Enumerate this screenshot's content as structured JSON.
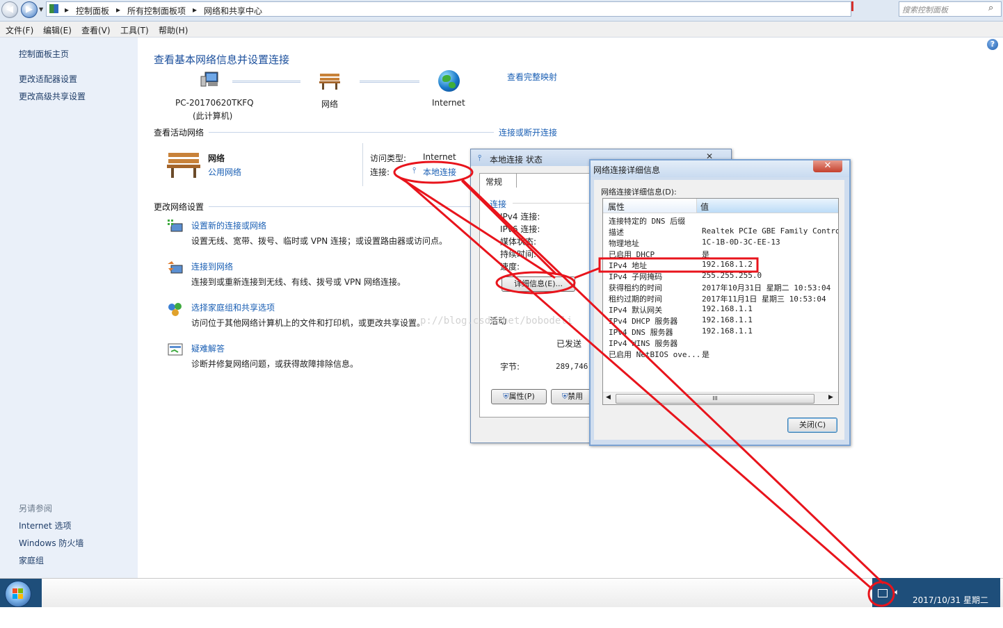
{
  "address": {
    "crumbs": [
      "控制面板",
      "所有控制面板项",
      "网络和共享中心"
    ],
    "search_placeholder": "搜索控制面板"
  },
  "menu": [
    "文件(F)",
    "编辑(E)",
    "查看(V)",
    "工具(T)",
    "帮助(H)"
  ],
  "sidebar": {
    "items": [
      "控制面板主页",
      "更改适配器设置",
      "更改高级共享设置"
    ],
    "see_also_title": "另请参阅",
    "see_also": [
      "Internet 选项",
      "Windows 防火墙",
      "家庭组"
    ]
  },
  "main": {
    "title": "查看基本网络信息并设置连接",
    "full_map": "查看完整映射",
    "map": {
      "computer_name": "PC-20170620TKFQ",
      "computer_sub": "(此计算机)",
      "network": "网络",
      "internet": "Internet"
    },
    "active_title": "查看活动网络",
    "connect_disconnect": "连接或断开连接",
    "active_network": {
      "name": "网络",
      "type": "公用网络",
      "access_label": "访问类型:",
      "access_value": "Internet",
      "conn_label": "连接:",
      "conn_value": "本地连接"
    },
    "change_title": "更改网络设置",
    "tasks": [
      {
        "title": "设置新的连接或网络",
        "desc": "设置无线、宽带、拨号、临时或 VPN 连接；或设置路由器或访问点。"
      },
      {
        "title": "连接到网络",
        "desc": "连接到或重新连接到无线、有线、拨号或 VPN 网络连接。"
      },
      {
        "title": "选择家庭组和共享选项",
        "desc": "访问位于其他网络计算机上的文件和打印机，或更改共享设置。"
      },
      {
        "title": "疑难解答",
        "desc": "诊断并修复网络问题，或获得故障排除信息。"
      }
    ]
  },
  "status_dialog": {
    "title": "本地连接 状态",
    "close": "✕",
    "tab": "常规",
    "group_connection": "连接",
    "labels": [
      "IPv4 连接:",
      "IPv6 连接:",
      "媒体状态:",
      "持续时间:",
      "速度:"
    ],
    "details_button": "详细信息(E)...",
    "group_activity": "活动",
    "sent_label": "已发送",
    "bytes_label": "字节:",
    "bytes_sent": "289,746,",
    "properties_button": "属性(P)",
    "disable_button": "禁用"
  },
  "details_dialog": {
    "title": "网络连接详细信息",
    "close": "✕",
    "group_label": "网络连接详细信息(D):",
    "col_property": "属性",
    "col_value": "值",
    "rows": [
      {
        "k": "连接特定的 DNS 后缀",
        "v": ""
      },
      {
        "k": "描述",
        "v": "Realtek PCIe GBE Family Controlle"
      },
      {
        "k": "物理地址",
        "v": "1C-1B-0D-3C-EE-13"
      },
      {
        "k": "已启用 DHCP",
        "v": "是"
      },
      {
        "k": "IPv4 地址",
        "v": "192.168.1.2"
      },
      {
        "k": "IPv4 子网掩码",
        "v": "255.255.255.0"
      },
      {
        "k": "获得租约的时间",
        "v": "2017年10月31日 星期二 10:53:04"
      },
      {
        "k": "租约过期的时间",
        "v": "2017年11月1日 星期三 10:53:04"
      },
      {
        "k": "IPv4 默认网关",
        "v": "192.168.1.1"
      },
      {
        "k": "IPv4 DHCP 服务器",
        "v": "192.168.1.1"
      },
      {
        "k": "IPv4 DNS 服务器",
        "v": "192.168.1.1"
      },
      {
        "k": "IPv4 WINS 服务器",
        "v": ""
      },
      {
        "k": "已启用 NetBIOS ove...",
        "v": "是"
      }
    ],
    "scroll_thumb": "III",
    "close_button": "关闭(C)"
  },
  "watermark": "p://blog.csdn.net/bobodeli",
  "taskbar": {
    "datetime": "2017/10/31 星期二"
  },
  "colors": {
    "annotation": "#e8141c",
    "link": "#1a5fb4",
    "tray": "#1e4e7a"
  }
}
